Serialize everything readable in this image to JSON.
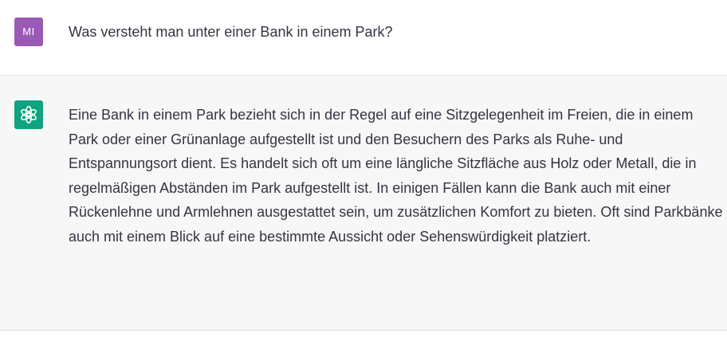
{
  "conversation": {
    "user": {
      "avatar_initials": "MI",
      "avatar_color": "#9b59b6",
      "message": "Was versteht man unter einer Bank in einem Park?"
    },
    "assistant": {
      "avatar_icon": "openai-logo-icon",
      "avatar_color": "#10a37f",
      "message": "Eine Bank in einem Park bezieht sich in der Regel auf eine Sitzgelegenheit im Freien, die in einem Park oder einer Grünanlage aufgestellt ist und den Besuchern des Parks als Ruhe- und Entspannungsort dient. Es handelt sich oft um eine längliche Sitzfläche aus Holz oder Metall, die in regelmäßigen Abständen im Park aufgestellt ist. In einigen Fällen kann die Bank auch mit einer Rückenlehne und Armlehnen ausgestattet sein, um zusätzlichen Komfort zu bieten. Oft sind Parkbänke auch mit einem Blick auf eine bestimmte Aussicht oder Sehenswürdigkeit platziert."
    }
  }
}
